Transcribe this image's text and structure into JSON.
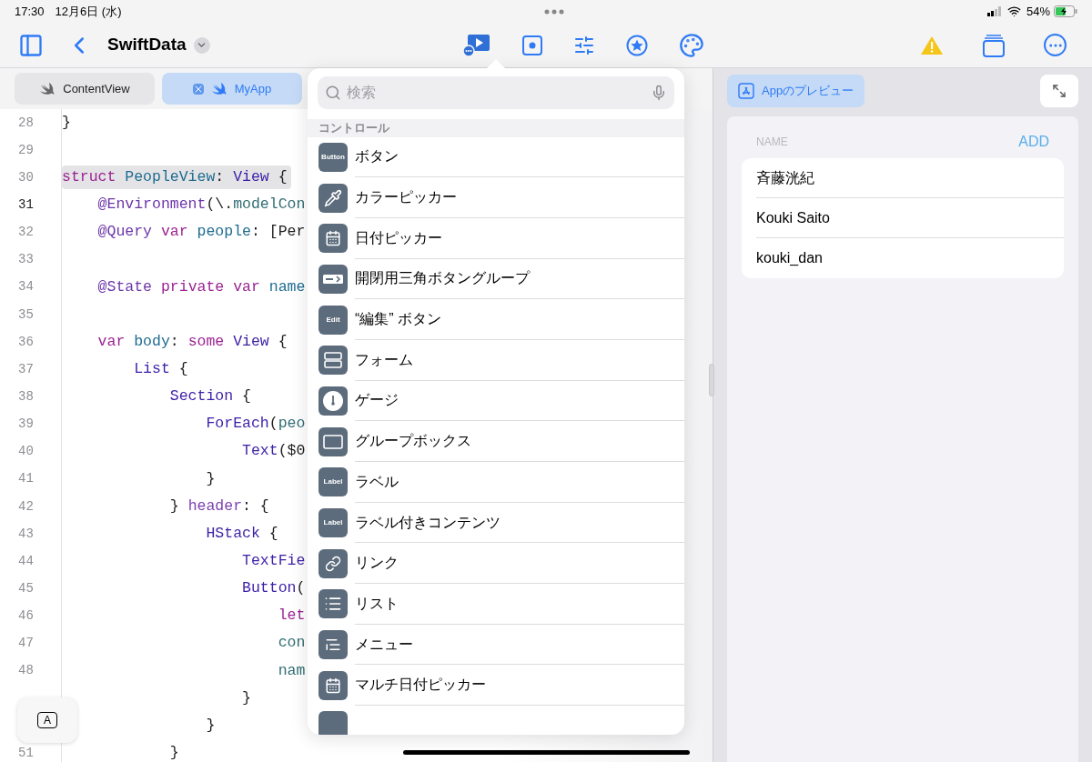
{
  "status_bar": {
    "time": "17:30",
    "date": "12月6日 (水)",
    "battery": "54%"
  },
  "nav": {
    "title": "SwiftData"
  },
  "tabs": [
    {
      "label": "ContentView",
      "selected": false
    },
    {
      "label": "MyApp",
      "selected": true
    }
  ],
  "code": [
    {
      "number": "28",
      "current": false,
      "highlighted": false,
      "tokens": [
        {
          "t": "}",
          "kind": "plain"
        }
      ]
    },
    {
      "number": "29",
      "current": false,
      "highlighted": false
    },
    {
      "number": "30",
      "current": false,
      "highlighted": true,
      "tokens": [
        {
          "t": "struct ",
          "kind": "kw"
        },
        {
          "t": "PeopleView",
          "kind": "decl"
        },
        {
          "t": ": ",
          "kind": "plain"
        },
        {
          "t": "View",
          "kind": "type"
        },
        {
          "t": " {",
          "kind": "plain"
        }
      ]
    },
    {
      "number": "31",
      "current": true,
      "highlighted": false,
      "tokens": [
        {
          "t": "    @Environment",
          "kind": "attr"
        },
        {
          "t": "(\\.",
          "kind": "plain"
        },
        {
          "t": "modelCon",
          "kind": "ref"
        }
      ]
    },
    {
      "number": "32",
      "current": false,
      "highlighted": false,
      "tokens": [
        {
          "t": "    @Query ",
          "kind": "attr"
        },
        {
          "t": "var ",
          "kind": "kw"
        },
        {
          "t": "people",
          "kind": "decl"
        },
        {
          "t": ": [Per",
          "kind": "plain"
        }
      ]
    },
    {
      "number": "33",
      "current": false,
      "highlighted": false
    },
    {
      "number": "34",
      "current": false,
      "highlighted": false,
      "tokens": [
        {
          "t": "    @State ",
          "kind": "attr"
        },
        {
          "t": "private var ",
          "kind": "kw"
        },
        {
          "t": "name",
          "kind": "decl"
        }
      ]
    },
    {
      "number": "35",
      "current": false,
      "highlighted": false
    },
    {
      "number": "36",
      "current": false,
      "highlighted": false,
      "tokens": [
        {
          "t": "    var ",
          "kind": "kw"
        },
        {
          "t": "body",
          "kind": "decl"
        },
        {
          "t": ": ",
          "kind": "plain"
        },
        {
          "t": "some ",
          "kind": "kw"
        },
        {
          "t": "View",
          "kind": "type"
        },
        {
          "t": " {",
          "kind": "plain"
        }
      ]
    },
    {
      "number": "37",
      "current": false,
      "highlighted": false,
      "tokens": [
        {
          "t": "        List",
          "kind": "type"
        },
        {
          "t": " {",
          "kind": "plain"
        }
      ]
    },
    {
      "number": "38",
      "current": false,
      "highlighted": false,
      "tokens": [
        {
          "t": "            Section",
          "kind": "type"
        },
        {
          "t": " {",
          "kind": "plain"
        }
      ]
    },
    {
      "number": "39",
      "current": false,
      "highlighted": false,
      "tokens": [
        {
          "t": "                ForEach",
          "kind": "type"
        },
        {
          "t": "(",
          "kind": "plain"
        },
        {
          "t": "peo",
          "kind": "ref"
        }
      ]
    },
    {
      "number": "40",
      "current": false,
      "highlighted": false,
      "tokens": [
        {
          "t": "                    Text",
          "kind": "type"
        },
        {
          "t": "($0",
          "kind": "plain"
        }
      ]
    },
    {
      "number": "41",
      "current": false,
      "highlighted": false,
      "tokens": [
        {
          "t": "                }",
          "kind": "plain"
        }
      ]
    },
    {
      "number": "42",
      "current": false,
      "highlighted": false,
      "tokens": [
        {
          "t": "            } ",
          "kind": "plain"
        },
        {
          "t": "header",
          "kind": "label"
        },
        {
          "t": ": {",
          "kind": "plain"
        }
      ]
    },
    {
      "number": "43",
      "current": false,
      "highlighted": false,
      "tokens": [
        {
          "t": "                HStack",
          "kind": "type"
        },
        {
          "t": " {",
          "kind": "plain"
        }
      ]
    },
    {
      "number": "44",
      "current": false,
      "highlighted": false,
      "tokens": [
        {
          "t": "                    TextFie",
          "kind": "type"
        }
      ]
    },
    {
      "number": "45",
      "current": false,
      "highlighted": false,
      "tokens": [
        {
          "t": "                    Button",
          "kind": "type"
        },
        {
          "t": "(",
          "kind": "plain"
        }
      ]
    },
    {
      "number": "46",
      "current": false,
      "highlighted": false,
      "tokens": [
        {
          "t": "                        let",
          "kind": "kw"
        }
      ]
    },
    {
      "number": "47",
      "current": false,
      "highlighted": false,
      "tokens": [
        {
          "t": "                        con",
          "kind": "ref"
        }
      ]
    },
    {
      "number": "48",
      "current": false,
      "highlighted": false,
      "tokens": [
        {
          "t": "                        nam",
          "kind": "ref"
        }
      ]
    },
    {
      "current": false,
      "highlighted": false,
      "tokens": [
        {
          "t": "                    }",
          "kind": "plain"
        }
      ]
    },
    {
      "current": false,
      "highlighted": false,
      "tokens": [
        {
          "t": "                }",
          "kind": "plain"
        }
      ]
    },
    {
      "number": "51",
      "current": false,
      "highlighted": false,
      "tokens": [
        {
          "t": "            }",
          "kind": "plain"
        }
      ]
    }
  ],
  "keyboard_button": {
    "label": "A"
  },
  "library": {
    "search": {
      "placeholder": "検索"
    },
    "section": "コントロール",
    "items": [
      {
        "kind": "text",
        "icon_text": "Button",
        "label": "ボタン"
      },
      {
        "kind": "eyedropper",
        "label": "カラーピッカー"
      },
      {
        "kind": "calendar",
        "label": "日付ピッカー"
      },
      {
        "kind": "disclosure",
        "label": "開閉用三角ボタングループ"
      },
      {
        "kind": "text",
        "icon_text": "Edit",
        "label": "“編集” ボタン"
      },
      {
        "kind": "form",
        "label": "フォーム"
      },
      {
        "kind": "gauge",
        "label": "ゲージ"
      },
      {
        "kind": "box",
        "label": "グループボックス"
      },
      {
        "kind": "text",
        "icon_text": "Label",
        "label": "ラベル"
      },
      {
        "kind": "text",
        "icon_text": "Label",
        "label": "ラベル付きコンテンツ"
      },
      {
        "kind": "link",
        "label": "リンク"
      },
      {
        "kind": "list",
        "label": "リスト"
      },
      {
        "kind": "menu",
        "label": "メニュー"
      },
      {
        "kind": "calendar",
        "label": "マルチ日付ピッカー"
      },
      {
        "kind": "hidden"
      }
    ]
  },
  "preview": {
    "button": "Appのプレビュー",
    "header": "NAME",
    "add": "ADD",
    "rows": [
      "斉藤洸紀",
      "Kouki Saito",
      "kouki_dan"
    ]
  }
}
